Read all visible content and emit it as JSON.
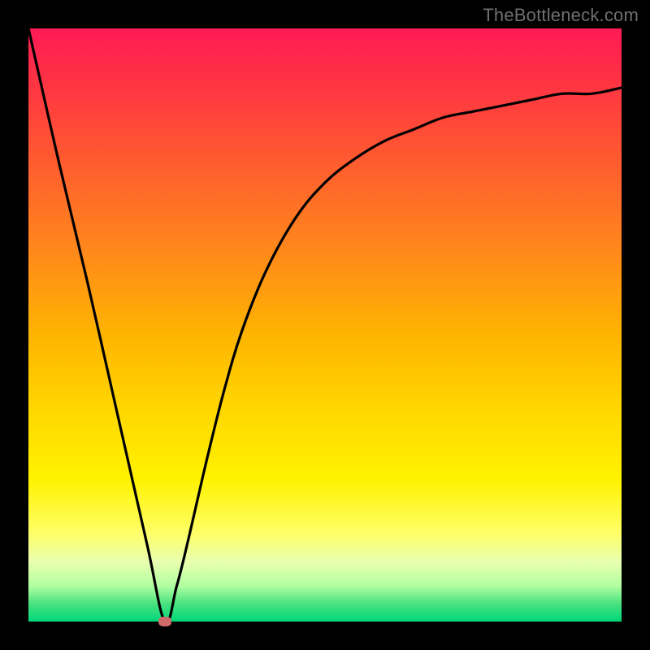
{
  "watermark": "TheBottleneck.com",
  "chart_data": {
    "type": "line",
    "title": "",
    "xlabel": "",
    "ylabel": "",
    "xlim": [
      0,
      100
    ],
    "ylim": [
      0,
      100
    ],
    "series": [
      {
        "name": "bottleneck-curve",
        "x": [
          0,
          5,
          10,
          15,
          20,
          23,
          25,
          27,
          30,
          33,
          36,
          40,
          45,
          50,
          55,
          60,
          65,
          70,
          75,
          80,
          85,
          90,
          95,
          100
        ],
        "y": [
          100,
          78,
          57,
          35,
          13,
          0,
          6,
          14,
          27,
          39,
          49,
          59,
          68,
          74,
          78,
          81,
          83,
          85,
          86,
          87,
          88,
          89,
          89,
          90
        ]
      }
    ],
    "marker": {
      "x": 23,
      "y": 0
    },
    "gradient_stops": [
      {
        "pos": 0,
        "color": "#ff1a55"
      },
      {
        "pos": 22,
        "color": "#ff5a30"
      },
      {
        "pos": 52,
        "color": "#ffb500"
      },
      {
        "pos": 76,
        "color": "#fff200"
      },
      {
        "pos": 94,
        "color": "#b0ffa0"
      },
      {
        "pos": 100,
        "color": "#00d67a"
      }
    ]
  }
}
